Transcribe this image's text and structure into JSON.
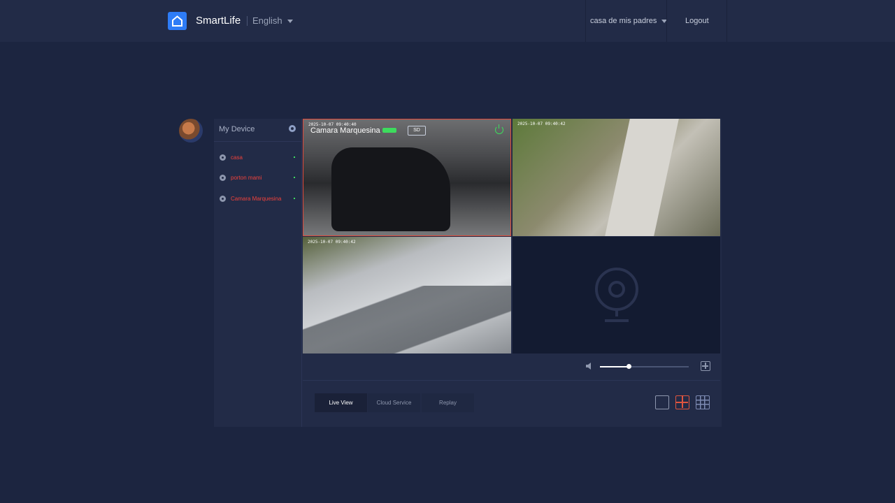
{
  "header": {
    "brand": "SmartLife",
    "language": "English",
    "home": "casa de mis padres",
    "logout": "Logout"
  },
  "sidebar": {
    "title": "My Device",
    "devices": [
      {
        "name": "casa",
        "status": "online"
      },
      {
        "name": "porton mami",
        "status": "online"
      },
      {
        "name": "Camara Marquesina",
        "status": "online"
      }
    ]
  },
  "cameras": [
    {
      "timestamp": "2025-10-07 09:40:40",
      "name": "Camara Marquesina",
      "quality": "SD",
      "selected": true
    },
    {
      "timestamp": "2025-10-07 09:40:42"
    },
    {
      "timestamp": "2025-10-07 09:40:42"
    },
    {
      "empty": true
    }
  ],
  "controls": {
    "volume": 0.32
  },
  "tabs": [
    {
      "label": "Live View",
      "active": true
    },
    {
      "label": "Cloud Service",
      "active": false
    },
    {
      "label": "Replay",
      "active": false
    }
  ],
  "layouts": [
    "single",
    "four",
    "nine"
  ],
  "active_layout": "four",
  "colors": {
    "accent": "#2e7cf6",
    "alert": "#f0423b",
    "online": "#3ddc5d",
    "selected_border": "#e04a3a"
  }
}
